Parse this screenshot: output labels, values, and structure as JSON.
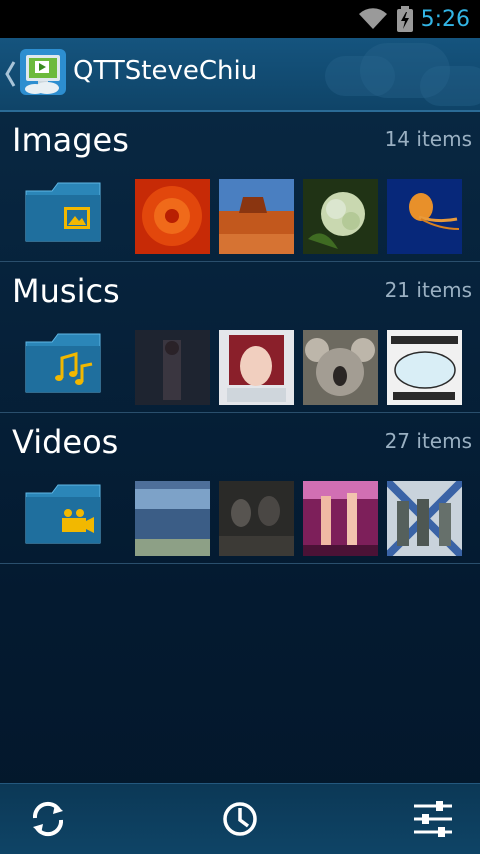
{
  "status_bar": {
    "time": "5:26"
  },
  "action_bar": {
    "title": "QTTSteveChiu"
  },
  "sections": [
    {
      "title": "Images",
      "count": "14 items",
      "icon": "image-icon"
    },
    {
      "title": "Musics",
      "count": "21 items",
      "icon": "music-note-icon"
    },
    {
      "title": "Videos",
      "count": "27 items",
      "icon": "video-camera-icon"
    }
  ],
  "bottom_bar": {
    "buttons": [
      "refresh-icon",
      "clock-icon",
      "settings-sliders-icon"
    ]
  },
  "colors": {
    "accent": "#33b5e5",
    "folder": "#2b86b8",
    "folder_icon": "#f2b800"
  }
}
